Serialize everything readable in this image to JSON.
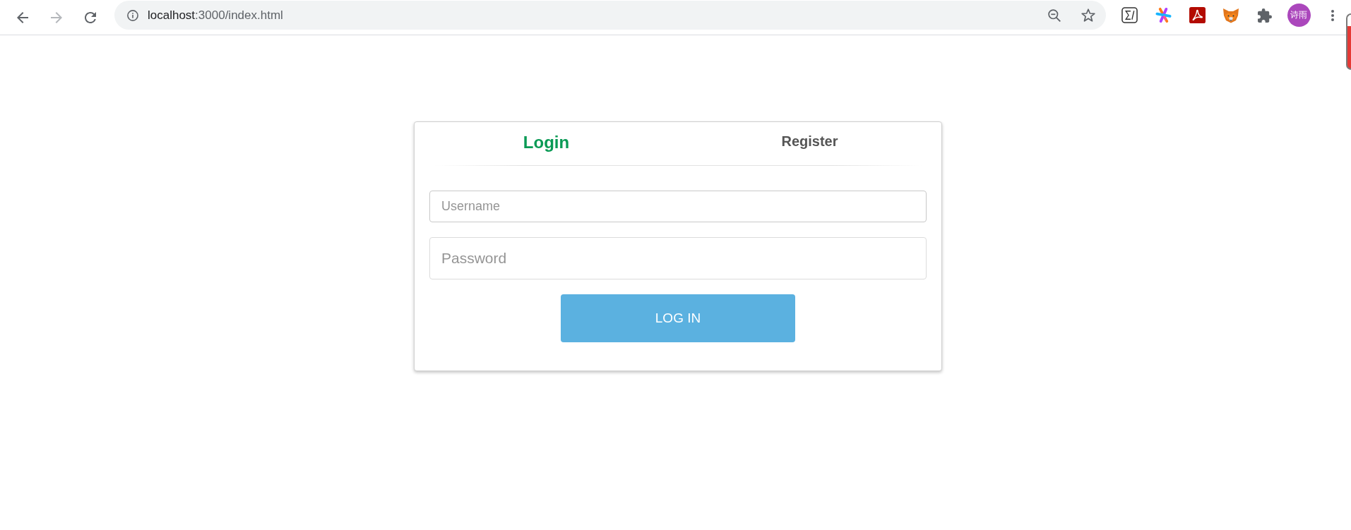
{
  "browser": {
    "nav_buttons": [
      {
        "kind": "back",
        "disabled": false
      },
      {
        "kind": "forward",
        "disabled": true
      },
      {
        "kind": "reload",
        "disabled": false
      }
    ],
    "url": {
      "host": "localhost",
      "path": ":3000/index.html"
    },
    "profile": {
      "label": "诗雨"
    }
  },
  "tabs": [
    {
      "label": "Login",
      "selected": true
    },
    {
      "label": "Register",
      "selected": false
    }
  ],
  "form": {
    "fields": [
      {
        "kind": "text",
        "placeholder": "Username"
      },
      {
        "kind": "password",
        "placeholder": "Password"
      }
    ],
    "submit": "LOG IN"
  }
}
